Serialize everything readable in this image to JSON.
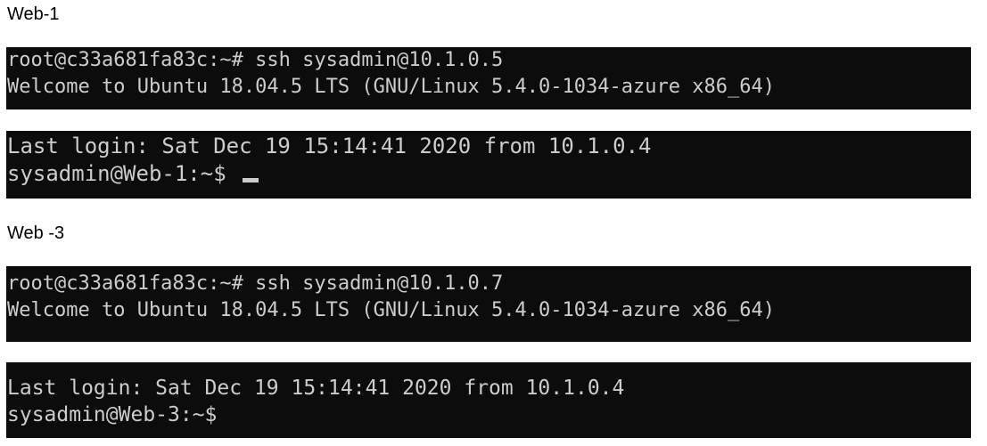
{
  "sections": [
    {
      "heading": "Web-1",
      "ssh_terminal": {
        "lines": [
          "root@c33a681fa83c:~# ssh sysadmin@10.1.0.5",
          "Welcome to Ubuntu 18.04.5 LTS (GNU/Linux 5.4.0-1034-azure x86_64)"
        ]
      },
      "login_terminal": {
        "lines": [
          "Last login: Sat Dec 19 15:14:41 2020 from 10.1.0.4",
          "sysadmin@Web-1:~$ "
        ],
        "cursor_visible": true
      }
    },
    {
      "heading": "Web -3",
      "ssh_terminal": {
        "lines": [
          "root@c33a681fa83c:~# ssh sysadmin@10.1.0.7",
          "Welcome to Ubuntu 18.04.5 LTS (GNU/Linux 5.4.0-1034-azure x86_64)"
        ]
      },
      "login_terminal": {
        "lines": [
          "Last login: Sat Dec 19 15:14:41 2020 from 10.1.0.4",
          "sysadmin@Web-3:~$"
        ],
        "cursor_visible": false
      }
    }
  ],
  "colors": {
    "terminal_background": "#0c0c0c",
    "terminal_text": "#cccccc",
    "page_background": "#ffffff"
  }
}
